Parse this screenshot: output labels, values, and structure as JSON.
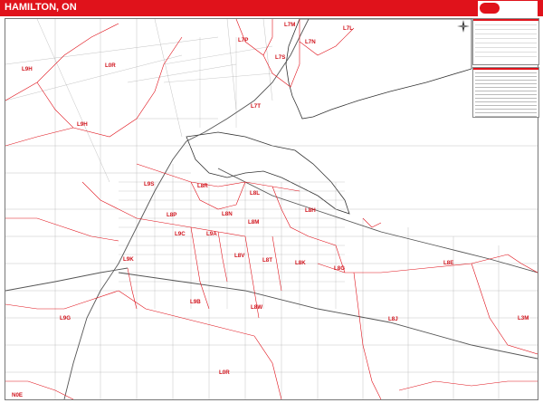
{
  "header": {
    "title": "HAMILTON, ON"
  },
  "colors": {
    "banner": "#e0121b",
    "boundary": "#e0121b",
    "road": "#9a9a9a",
    "highway": "#555555",
    "water_edge": "#333333",
    "label": "#d0121b"
  },
  "icons": {
    "compass": "compass-rose-icon",
    "logo": "publisher-logo-icon"
  },
  "zones": [
    {
      "code": "L7M"
    },
    {
      "code": "L7L"
    },
    {
      "code": "L7P"
    },
    {
      "code": "L7N"
    },
    {
      "code": "L9H"
    },
    {
      "code": "L0R"
    },
    {
      "code": "L7S"
    },
    {
      "code": "L7T"
    },
    {
      "code": "L9H"
    },
    {
      "code": "L9S"
    },
    {
      "code": "L8R"
    },
    {
      "code": "L8L"
    },
    {
      "code": "L8H"
    },
    {
      "code": "L8P"
    },
    {
      "code": "L8N"
    },
    {
      "code": "L8M"
    },
    {
      "code": "L9C"
    },
    {
      "code": "L9A"
    },
    {
      "code": "L9K"
    },
    {
      "code": "L8V"
    },
    {
      "code": "L8T"
    },
    {
      "code": "L8K"
    },
    {
      "code": "L8G"
    },
    {
      "code": "L8E"
    },
    {
      "code": "L9B"
    },
    {
      "code": "L8W"
    },
    {
      "code": "L9G"
    },
    {
      "code": "L8J"
    },
    {
      "code": "L3M"
    },
    {
      "code": "L0R"
    },
    {
      "code": "N0E"
    }
  ]
}
